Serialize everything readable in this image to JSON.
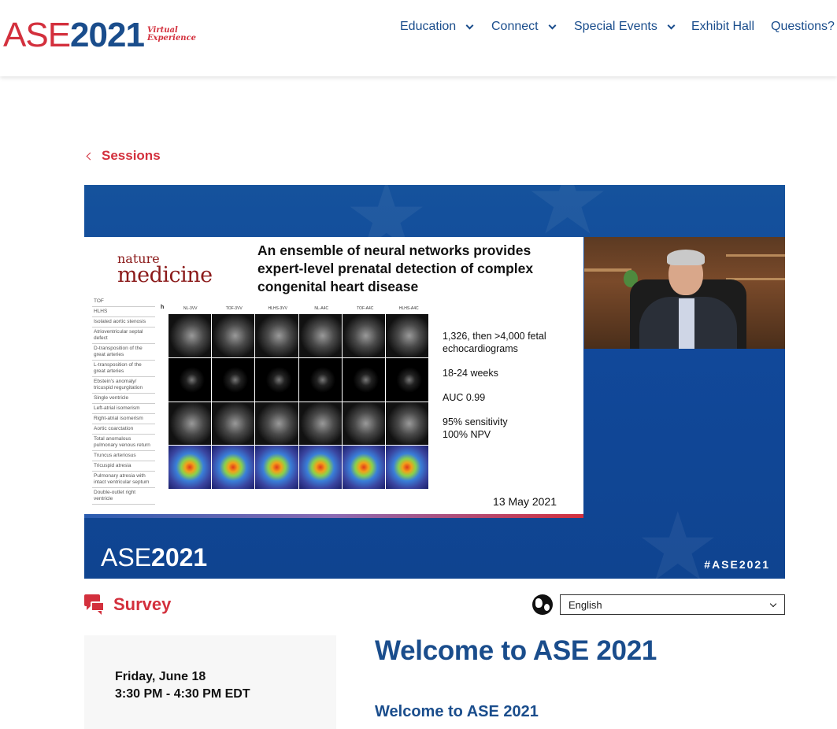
{
  "logo": {
    "ase": "ASE",
    "year": "2021",
    "sub_line1": "Virtual",
    "sub_line2": "Experience"
  },
  "nav": {
    "education": "Education",
    "connect": "Connect",
    "special_events": "Special Events",
    "exhibit_hall": "Exhibit Hall",
    "questions": "Questions?"
  },
  "breadcrumb": {
    "back_label": "Sessions"
  },
  "video": {
    "slide": {
      "journal_line1": "nature",
      "journal_line2": "medicine",
      "title": "An ensemble of neural networks provides expert-level prenatal detection of complex congenital heart disease",
      "row_labels": [
        "TOF",
        "HLHS",
        "Isolated aortic stenosis",
        "Atrioventricular septal defect",
        "D-transposition of the great arteries",
        "L-transposition of the great arteries",
        "Ebstein's anomaly/ tricuspid regurgitation",
        "Single ventricle",
        "Left-atrial isomerism",
        "Right-atrial isomerism",
        "Aortic coarctation",
        "Total anomalous pulmonary venous return",
        "Truncus arteriosus",
        "Tricuspid atresia",
        "Pulmonary atresia with intact ventricular septum",
        "Double-outlet right ventricle"
      ],
      "panel_letter": "h",
      "column_headers": [
        "NL-3VV",
        "TOF-3VV",
        "HLHS-3VV",
        "NL-A4C",
        "TOF-A4C",
        "HLHS-A4C"
      ],
      "stats": [
        "1,326, then >4,000 fetal echocardiograms",
        "18-24 weeks",
        "AUC 0.99",
        "95% sensitivity",
        "100% NPV"
      ],
      "date": "13 May 2021"
    },
    "brand_ase": "ASE",
    "brand_year": "2021",
    "hashtag": "#ASE2021"
  },
  "survey": {
    "label": "Survey"
  },
  "language": {
    "selected": "English"
  },
  "session": {
    "day": "Friday, June 18",
    "time": "3:30 PM - 4:30 PM EDT"
  },
  "main": {
    "title": "Welcome to ASE 2021",
    "subtitle": "Welcome to ASE 2021"
  },
  "colors": {
    "brand_red": "#d3303d",
    "brand_blue": "#1a4d8c",
    "video_blue": "#11489a"
  }
}
